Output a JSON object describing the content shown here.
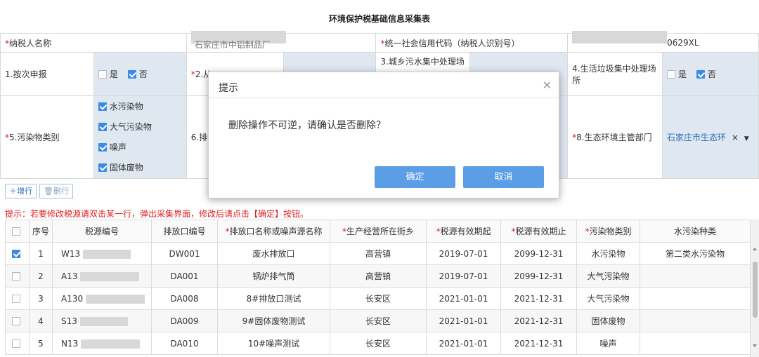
{
  "form": {
    "title": "环境保护税基础信息采集表",
    "taxpayer_name_label": "纳税人名称",
    "taxpayer_name_value_visible": "石家庄市中铝制品厂",
    "credit_code_label": "统一社会信用代码（纳税人识别号）",
    "credit_code_value_visible": "0629XL",
    "q1_label": "1.按次申报",
    "q2_label": "2.从",
    "q3_label": "3.城乡污水集中处理场",
    "q4_label": "4.生活垃圾集中处理场所",
    "q5_label": "5.污染物类别",
    "q6_label": "6.排",
    "q8_label": "8.生态环境主管部门",
    "q8_value": "石家庄市生态环",
    "yes": "是",
    "no": "否",
    "pollutants": [
      "水污染物",
      "大气污染物",
      "噪声",
      "固体废物"
    ]
  },
  "toolbar": {
    "add_label": "增行",
    "delete_label": "删行"
  },
  "tip": "提示：若要修改税源请双击某一行，弹出采集界面，修改后请点击【确定】按钮。",
  "grid": {
    "headers": [
      "序号",
      "税源编号",
      "排放口编号",
      "排放口名称或噪声源名称",
      "生产经营所在街乡",
      "税源有效期起",
      "税源有效期止",
      "污染物类别",
      "水污染种类"
    ],
    "rows": [
      {
        "checked": true,
        "no": "1",
        "code": "W13",
        "outlet": "DW001",
        "name": "废水排放口",
        "street": "高营镇",
        "start": "2019-07-01",
        "end": "2099-12-31",
        "type": "水污染物",
        "water": "第二类水污染物"
      },
      {
        "checked": false,
        "no": "2",
        "code": "A13",
        "outlet": "DA001",
        "name": "锅炉排气筒",
        "street": "高营镇",
        "start": "2019-07-01",
        "end": "2099-12-31",
        "type": "大气污染物",
        "water": ""
      },
      {
        "checked": false,
        "no": "3",
        "code": "A130",
        "outlet": "DA008",
        "name": "8#排放口测试",
        "street": "长安区",
        "start": "2021-01-01",
        "end": "2021-12-31",
        "type": "大气污染物",
        "water": ""
      },
      {
        "checked": false,
        "no": "4",
        "code": "S13",
        "outlet": "DA009",
        "name": "9#固体废物测试",
        "street": "长安区",
        "start": "2021-01-01",
        "end": "2021-12-31",
        "type": "固体废物",
        "water": ""
      },
      {
        "checked": false,
        "no": "5",
        "code": "N13",
        "outlet": "DA010",
        "name": "10#噪声测试",
        "street": "长安区",
        "start": "2021-01-01",
        "end": "2021-12-31",
        "type": "噪声",
        "water": ""
      }
    ]
  },
  "dialog": {
    "title": "提示",
    "message": "删除操作不可逆，请确认是否删除？",
    "ok_label": "确定",
    "cancel_label": "取消"
  },
  "colors": {
    "accent": "#5b9ee6",
    "required": "#e02020",
    "value_bg": "#dfe7f1",
    "link": "#2f6cb8"
  }
}
